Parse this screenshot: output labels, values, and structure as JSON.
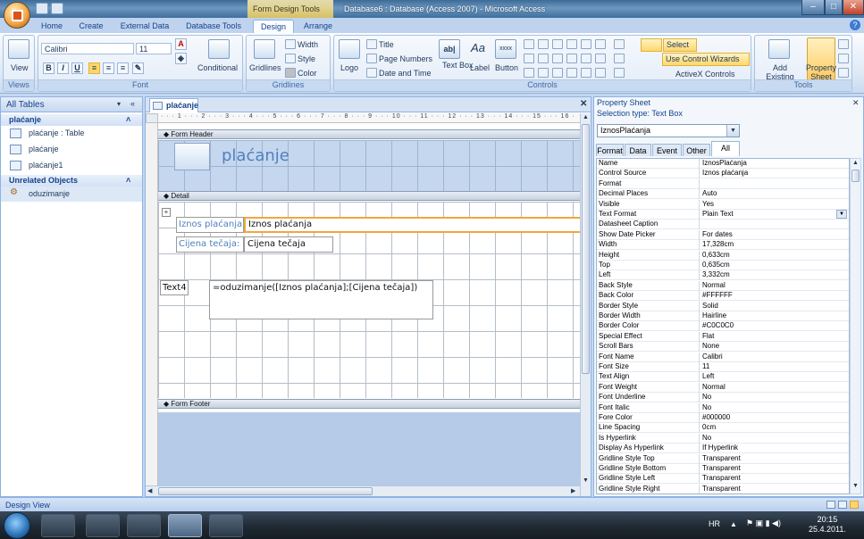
{
  "window": {
    "context_tab": "Form Design Tools",
    "title": "Database6 : Database (Access 2007) - Microsoft Access"
  },
  "ribbon_tabs": [
    "Home",
    "Create",
    "External Data",
    "Database Tools",
    "Design",
    "Arrange"
  ],
  "ribbon": {
    "views": {
      "view_label": "View",
      "caption": "Views"
    },
    "font": {
      "font_name": "Calibri",
      "font_size": "11",
      "conditional_label": "Conditional",
      "caption": "Font",
      "bold": "B",
      "italic": "I",
      "underline": "U"
    },
    "gridlines": {
      "gridlines_label": "Gridlines",
      "width_label": "Width",
      "style_label": "Style",
      "color_label": "Color",
      "caption": "Gridlines"
    },
    "controls": {
      "logo_label": "Logo",
      "title_label": "Title",
      "page_numbers_label": "Page Numbers",
      "date_time_label": "Date and Time",
      "text_box_label": "Text Box",
      "label_label": "Label",
      "button_label": "Button",
      "select_label": "Select",
      "use_control_wizards_label": "Use Control Wizards",
      "activex_label": "ActiveX Controls",
      "caption": "Controls",
      "textbox_glyph": "ab|",
      "label_glyph": "Aa",
      "button_glyph": "xxxx"
    },
    "tools": {
      "add_existing_fields_label": "Add Existing Fields",
      "property_sheet_label": "Property Sheet",
      "caption": "Tools"
    }
  },
  "nav": {
    "header": "All Tables",
    "groups": [
      {
        "name": "plaćanje",
        "items": [
          "plaćanje : Table",
          "plaćanje",
          "plaćanje1"
        ]
      },
      {
        "name": "Unrelated Objects",
        "items": [
          "oduzimanje"
        ]
      }
    ]
  },
  "document": {
    "tab_label": "plaćanje",
    "ruler_text": "· · · 1 · · · 2 · · · 3 · · · 4 · · · 5 · · · 6 · · · 7 · · · 8 · · · 9 · · · 10 · · · 11 · · · 12 · · · 13 · · · 14 · · · 15 · · · 16 ·",
    "sections": {
      "header": "Form Header",
      "detail": "Detail",
      "footer": "Form Footer"
    },
    "form_title": "plaćanje",
    "controls": {
      "label1": "Iznos plaćanja:",
      "textbox1": "Iznos plaćanja",
      "label2": "Cijena tečaja:",
      "textbox2": "Cijena tečaja",
      "label3": "Text4",
      "textbox3": "=oduzimanje([Iznos plaćanja];[Cijena tečaja])"
    }
  },
  "property_sheet": {
    "title": "Property Sheet",
    "selection_type": "Selection type:  Text Box",
    "selected_control": "IznosPlaćanja",
    "tabs": [
      "Format",
      "Data",
      "Event",
      "Other",
      "All"
    ],
    "active_tab": "All",
    "rows": [
      [
        "Name",
        "IznosPlaćanja"
      ],
      [
        "Control Source",
        "Iznos plaćanja"
      ],
      [
        "Format",
        ""
      ],
      [
        "Decimal Places",
        "Auto"
      ],
      [
        "Visible",
        "Yes"
      ],
      [
        "Text Format",
        "Plain Text"
      ],
      [
        "Datasheet Caption",
        ""
      ],
      [
        "Show Date Picker",
        "For dates"
      ],
      [
        "Width",
        "17,328cm"
      ],
      [
        "Height",
        "0,633cm"
      ],
      [
        "Top",
        "0,635cm"
      ],
      [
        "Left",
        "3,332cm"
      ],
      [
        "Back Style",
        "Normal"
      ],
      [
        "Back Color",
        "#FFFFFF"
      ],
      [
        "Border Style",
        "Solid"
      ],
      [
        "Border Width",
        "Hairline"
      ],
      [
        "Border Color",
        "#C0C0C0"
      ],
      [
        "Special Effect",
        "Flat"
      ],
      [
        "Scroll Bars",
        "None"
      ],
      [
        "Font Name",
        "Calibri"
      ],
      [
        "Font Size",
        "11"
      ],
      [
        "Text Align",
        "Left"
      ],
      [
        "Font Weight",
        "Normal"
      ],
      [
        "Font Underline",
        "No"
      ],
      [
        "Font Italic",
        "No"
      ],
      [
        "Fore Color",
        "#000000"
      ],
      [
        "Line Spacing",
        "0cm"
      ],
      [
        "Is Hyperlink",
        "No"
      ],
      [
        "Display As Hyperlink",
        "If Hyperlink"
      ],
      [
        "Gridline Style Top",
        "Transparent"
      ],
      [
        "Gridline Style Bottom",
        "Transparent"
      ],
      [
        "Gridline Style Left",
        "Transparent"
      ],
      [
        "Gridline Style Right",
        "Transparent"
      ]
    ]
  },
  "status_bar": {
    "text": "Design View"
  },
  "taskbar": {
    "language": "HR",
    "time": "20:15",
    "date": "25.4.2011."
  },
  "colors": {
    "accent": "#e6a23c",
    "ribbon_bg": "#dde8f6",
    "title_bar": "#4f7eab"
  }
}
